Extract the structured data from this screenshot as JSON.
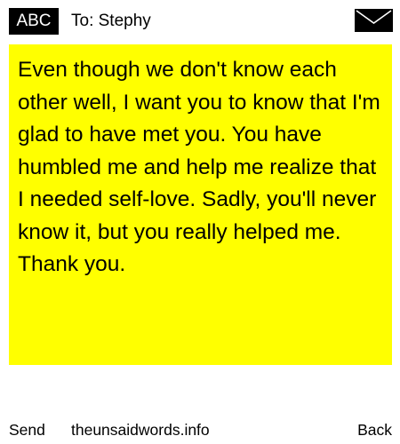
{
  "header": {
    "badge_label": "ABC",
    "recipient": "To: Stephy",
    "envelope_icon": "envelope-icon"
  },
  "message": {
    "text": "Even though we don't know each other well, I want you to know that I'm glad to have met you. You have humbled me and help me realize that I needed self-love. Sadly, you'll never know it, but you really helped me. Thank you."
  },
  "footer": {
    "send_label": "Send",
    "site_label": "theunsaidwords.info",
    "back_label": "Back"
  },
  "colors": {
    "card_background": "#ffff00",
    "badge_background": "#000000",
    "badge_text": "#ffffff",
    "text": "#000000",
    "page_background": "#ffffff"
  }
}
